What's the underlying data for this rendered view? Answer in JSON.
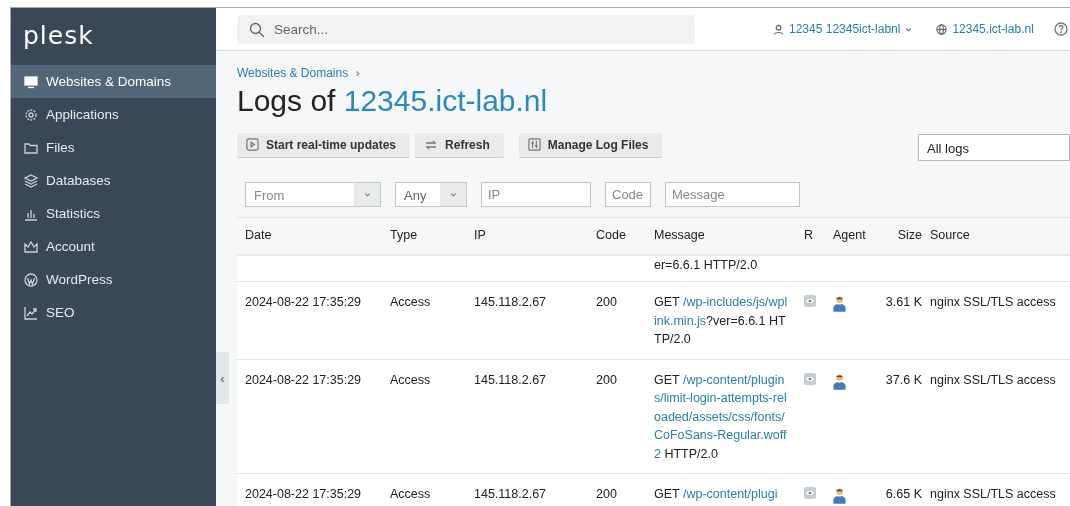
{
  "sidebar": {
    "logo": "plesk",
    "items": [
      {
        "label": "Websites & Domains",
        "selected": true
      },
      {
        "label": "Applications",
        "selected": false
      },
      {
        "label": "Files",
        "selected": false
      },
      {
        "label": "Databases",
        "selected": false
      },
      {
        "label": "Statistics",
        "selected": false
      },
      {
        "label": "Account",
        "selected": false
      },
      {
        "label": "WordPress",
        "selected": false
      },
      {
        "label": "SEO",
        "selected": false
      }
    ],
    "collapse": "‹"
  },
  "topbar": {
    "search": {
      "placeholder": "Search..."
    },
    "user": "12345 12345ict-labnl",
    "domain": "12345.ict-lab.nl"
  },
  "breadcrumb": [
    "Websites & Domains"
  ],
  "title": {
    "prefix": "Logs of ",
    "domain": "12345.ict-lab.nl"
  },
  "toolbar": {
    "buttons": [
      {
        "label": "Start real-time updates"
      },
      {
        "label": "Refresh"
      },
      {
        "label": "Manage Log Files"
      }
    ],
    "log_select": "All logs"
  },
  "filters": {
    "from": {
      "placeholder": "From"
    },
    "type": {
      "value": "Any"
    },
    "ip": {
      "placeholder": "IP"
    },
    "code": {
      "placeholder": "Code"
    },
    "message": {
      "placeholder": "Message"
    }
  },
  "table": {
    "columns": [
      "Date",
      "Type",
      "IP",
      "Code",
      "Message",
      "R",
      "Agent",
      "Size",
      "Source"
    ],
    "rows": [
      {
        "message": {
          "suffix": "er=6.6.1 HTTP/2.0"
        }
      },
      {
        "date": "2024-08-22 17:35:29",
        "type": "Access",
        "ip": "145.118.2.67",
        "code": "200",
        "message": {
          "method": "GET ",
          "path": "/wp-includes/js/wplink.min.js",
          "suffix": "?ver=6.6.1 HTTP/2.0"
        },
        "size": "3.61 K",
        "source": "nginx SSL/TLS access"
      },
      {
        "date": "2024-08-22 17:35:29",
        "type": "Access",
        "ip": "145.118.2.67",
        "code": "200",
        "message": {
          "method": "GET ",
          "path": "/wp-content/plugins/limit-login-attempts-reloaded/assets/css/fonts/CoFoSans-Regular.woff2",
          "suffix": " HTTP/2.0"
        },
        "size": "37.6 K",
        "source": "nginx SSL/TLS access"
      },
      {
        "date": "2024-08-22 17:35:29",
        "type": "Access",
        "ip": "145.118.2.67",
        "code": "200",
        "message": {
          "method": "GET ",
          "path": "/wp-content/plugi"
        },
        "size": "6.65 K",
        "source": "nginx SSL/TLS access"
      }
    ]
  }
}
